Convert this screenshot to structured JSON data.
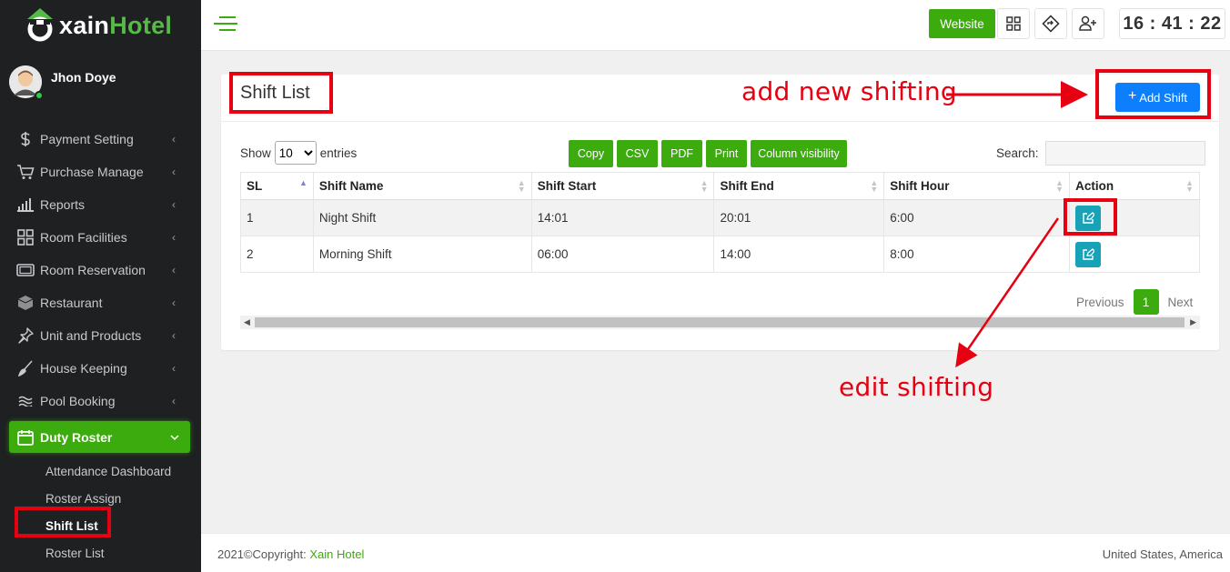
{
  "brand": {
    "logo_prefix": "xain",
    "logo_suffix": "Hotel"
  },
  "user": {
    "name": "Jhon Doye"
  },
  "sidebar": {
    "items": [
      {
        "label": "Payment Setting",
        "icon": "dollar-icon"
      },
      {
        "label": "Purchase Manage",
        "icon": "cart-icon"
      },
      {
        "label": "Reports",
        "icon": "bar-chart-icon"
      },
      {
        "label": "Room Facilities",
        "icon": "grid-icon"
      },
      {
        "label": "Room Reservation",
        "icon": "room-icon"
      },
      {
        "label": "Restaurant",
        "icon": "cube-icon"
      },
      {
        "label": "Unit and Products",
        "icon": "pin-icon"
      },
      {
        "label": "House Keeping",
        "icon": "broom-icon"
      },
      {
        "label": "Pool Booking",
        "icon": "wave-icon"
      },
      {
        "label": "Duty Roster",
        "icon": "calendar-icon"
      }
    ],
    "submenu": [
      {
        "label": "Attendance Dashboard"
      },
      {
        "label": "Roster Assign"
      },
      {
        "label": "Shift List"
      },
      {
        "label": "Roster List"
      }
    ]
  },
  "topbar": {
    "website_label": "Website",
    "clock": "16 : 41 : 22"
  },
  "page": {
    "title": "Shift List",
    "add_button": "Add Shift",
    "show_label": "Show",
    "entries_value": "10",
    "entries_label": "entries",
    "search_label": "Search:",
    "export_buttons": [
      "Copy",
      "CSV",
      "PDF",
      "Print",
      "Column visibility"
    ]
  },
  "table": {
    "headers": [
      "SL",
      "Shift Name",
      "Shift Start",
      "Shift End",
      "Shift Hour",
      "Action"
    ],
    "rows": [
      {
        "sl": "1",
        "name": "Night Shift",
        "start": "14:01",
        "end": "20:01",
        "hour": "6:00"
      },
      {
        "sl": "2",
        "name": "Morning Shift",
        "start": "06:00",
        "end": "14:00",
        "hour": "8:00"
      }
    ]
  },
  "pagination": {
    "previous": "Previous",
    "current": "1",
    "next": "Next"
  },
  "footer": {
    "copyright": "2021©Copyright: ",
    "brand": "Xain Hotel",
    "location": "United States, America"
  },
  "annotations": {
    "add_note": "add new shifting",
    "edit_note": "edit shifting"
  },
  "colors": {
    "accent_green": "#3cab0e",
    "primary_blue": "#0d7efc",
    "info_teal": "#17a2b8",
    "annotation_red": "#e60012",
    "sidebar_bg": "#1e2022"
  }
}
